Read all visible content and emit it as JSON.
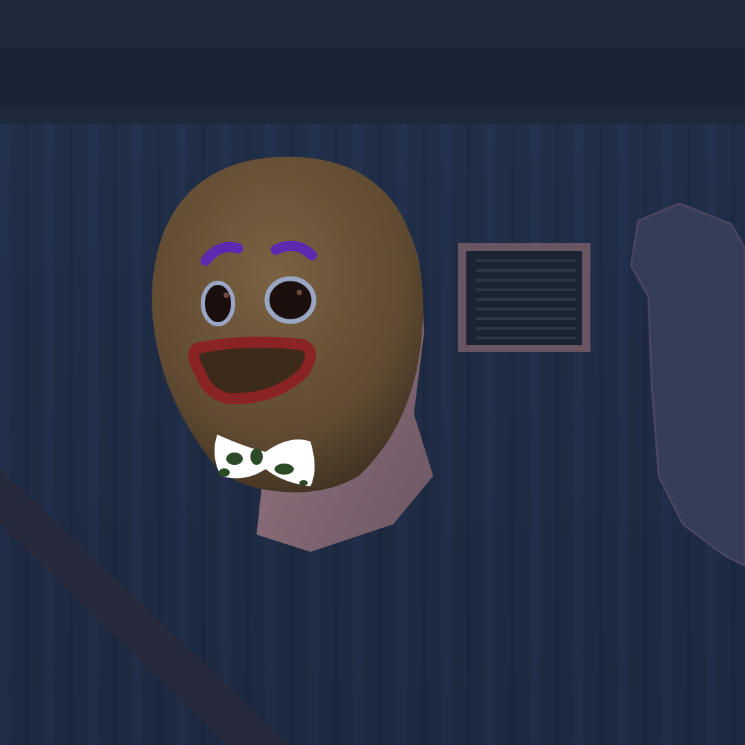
{
  "scene": {
    "subject": "gingerbread-mask-head",
    "colors": {
      "wall": "#1e2b44",
      "wall_stripe": "#24334f",
      "beam": "#1a2536",
      "mask": "#6b5438",
      "mask_shadow": "#4a3a27",
      "eyebrow": "#5a2bb0",
      "eye_ring": "#9aa6c4",
      "pupil": "#1a0f0c",
      "lips": "#8a2424",
      "mouth": "#3c2a1b",
      "bowtie": "#ffffff",
      "bowtie_spots": "#2b4a26",
      "skin": "#8c6f78",
      "vent": "#6a5563",
      "pipe": "#3c4460"
    }
  }
}
